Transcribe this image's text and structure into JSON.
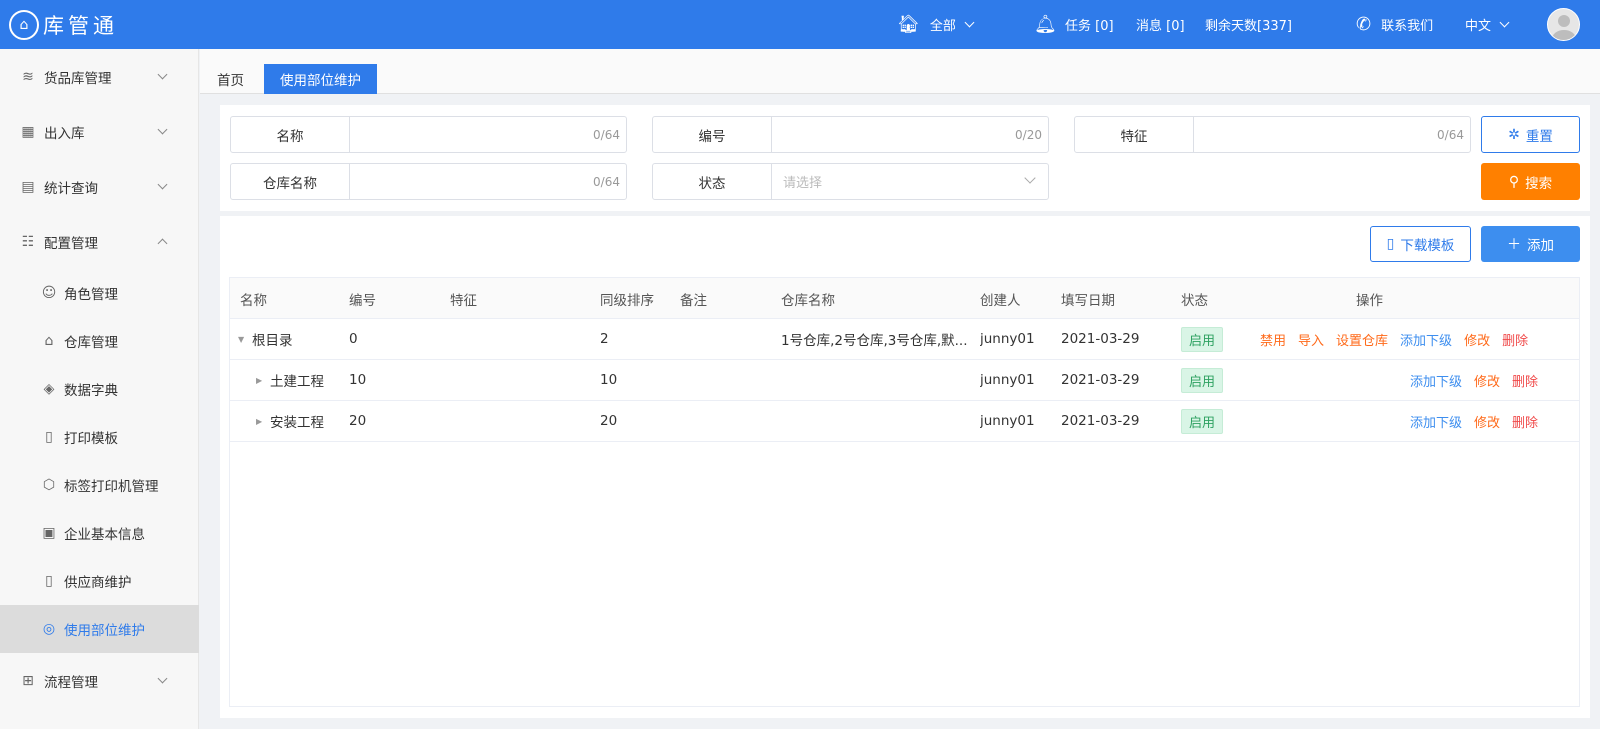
{
  "app": {
    "logo_icon": "building-icon",
    "title": "库管通"
  },
  "header": {
    "scope": {
      "icon": "warehouse-icon",
      "label": "全部"
    },
    "notify": {
      "icon": "bell-icon",
      "tasks": "任务 [0]",
      "messages": "消息 [0]",
      "days_left": "剩余天数[337]"
    },
    "contact": {
      "icon": "phone-icon",
      "label": "联系我们"
    },
    "language": "中文"
  },
  "sidebar": {
    "groups": [
      {
        "label": "货品库管理",
        "icon": "database-icon",
        "expanded": false
      },
      {
        "label": "出入库",
        "icon": "boxes-icon",
        "expanded": false
      },
      {
        "label": "统计查询",
        "icon": "report-icon",
        "expanded": false
      },
      {
        "label": "配置管理",
        "icon": "sliders-icon",
        "expanded": true
      }
    ],
    "config_items": [
      {
        "label": "角色管理",
        "icon": "user-gear-icon"
      },
      {
        "label": "仓库管理",
        "icon": "house-icon"
      },
      {
        "label": "数据字典",
        "icon": "dictionary-icon"
      },
      {
        "label": "打印模板",
        "icon": "document-icon"
      },
      {
        "label": "标签打印机管理",
        "icon": "cube-icon"
      },
      {
        "label": "企业基本信息",
        "icon": "calendar-icon"
      },
      {
        "label": "供应商维护",
        "icon": "file-search-icon"
      },
      {
        "label": "使用部位维护",
        "icon": "location-icon",
        "active": true
      }
    ],
    "last_group": {
      "label": "流程管理",
      "icon": "flow-icon",
      "expanded": false
    }
  },
  "tabs": {
    "home": "首页",
    "active": "使用部位维护"
  },
  "search": {
    "name": {
      "label": "名称",
      "counter": "0/64"
    },
    "code": {
      "label": "编号",
      "counter": "0/20"
    },
    "feature": {
      "label": "特征",
      "counter": "0/64"
    },
    "warehouse": {
      "label": "仓库名称",
      "counter": "0/64"
    },
    "status": {
      "label": "状态",
      "placeholder": "请选择"
    },
    "reset_label": "重置",
    "search_label": "搜索"
  },
  "toolbar": {
    "download_label": "下载模板",
    "add_label": "添加"
  },
  "table": {
    "columns": [
      "名称",
      "编号",
      "特征",
      "同级排序",
      "备注",
      "仓库名称",
      "创建人",
      "填写日期",
      "状态",
      "操作"
    ],
    "rows": [
      {
        "name": "根目录",
        "code": "0",
        "feature": "",
        "sort": "2",
        "remark": "",
        "warehouse": "1号仓库,2号仓库,3号仓库,默...",
        "creator": "junny01",
        "date": "2021-03-29",
        "status": "启用",
        "expanded": true,
        "actions": [
          {
            "label": "禁用",
            "tone": "orange"
          },
          {
            "label": "导入",
            "tone": "orange"
          },
          {
            "label": "设置仓库",
            "tone": "orange"
          },
          {
            "label": "添加下级",
            "tone": "blue"
          },
          {
            "label": "修改",
            "tone": "orange"
          },
          {
            "label": "删除",
            "tone": "red"
          }
        ]
      },
      {
        "name": "土建工程",
        "code": "10",
        "feature": "",
        "sort": "10",
        "remark": "",
        "warehouse": "",
        "creator": "junny01",
        "date": "2021-03-29",
        "status": "启用",
        "expanded": false,
        "actions": [
          {
            "label": "添加下级",
            "tone": "blue"
          },
          {
            "label": "修改",
            "tone": "orange"
          },
          {
            "label": "删除",
            "tone": "red"
          }
        ]
      },
      {
        "name": "安装工程",
        "code": "20",
        "feature": "",
        "sort": "20",
        "remark": "",
        "warehouse": "",
        "creator": "junny01",
        "date": "2021-03-29",
        "status": "启用",
        "expanded": false,
        "actions": [
          {
            "label": "添加下级",
            "tone": "blue"
          },
          {
            "label": "修改",
            "tone": "orange"
          },
          {
            "label": "删除",
            "tone": "red"
          }
        ]
      }
    ]
  }
}
